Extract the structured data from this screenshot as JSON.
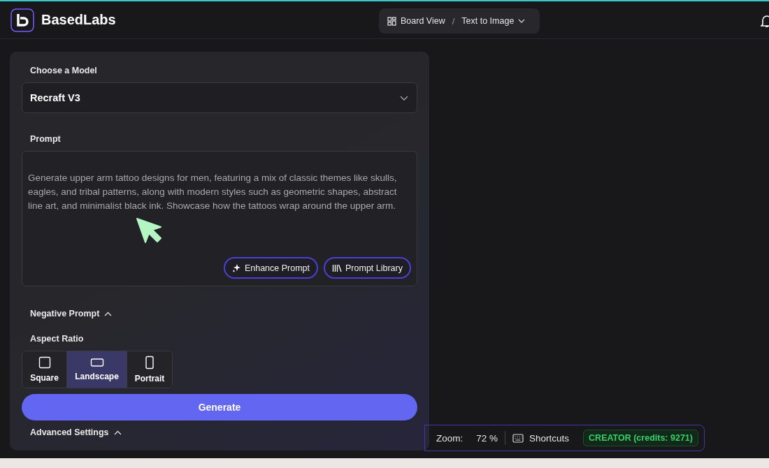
{
  "header": {
    "brand": "BasedLabs",
    "breadcrumb": {
      "view": "Board View",
      "separator": "/",
      "page": "Text to Image"
    }
  },
  "panel": {
    "model": {
      "label": "Choose a Model",
      "value": "Recraft V3"
    },
    "prompt": {
      "label": "Prompt",
      "value": "Generate upper arm tattoo designs for men, featuring a mix of classic themes like skulls, eagles, and tribal patterns, along with modern styles such as geometric shapes, abstract line art, and minimalist black ink. Showcase how the tattoos wrap around the upper arm.",
      "buttons": [
        {
          "kind": "enhance",
          "label": "Enhance Prompt"
        },
        {
          "kind": "library",
          "label": "Prompt Library"
        }
      ]
    },
    "negative_prompt": {
      "label": "Negative Prompt",
      "expanded": true
    },
    "aspect_ratio": {
      "label": "Aspect Ratio",
      "options": [
        {
          "kind": "square",
          "label": "Square",
          "selected": false
        },
        {
          "kind": "landscape",
          "label": "Landscape",
          "selected": true
        },
        {
          "kind": "portrait",
          "label": "Portrait",
          "selected": false
        }
      ]
    },
    "generate": "Generate",
    "advanced_settings": {
      "label": "Advanced Settings",
      "expanded": true
    }
  },
  "status_bar": {
    "zoom_label": "Zoom:",
    "zoom_value": "72 %",
    "shortcuts": "Shortcuts",
    "plan": "CREATOR (credits: 9271)"
  }
}
